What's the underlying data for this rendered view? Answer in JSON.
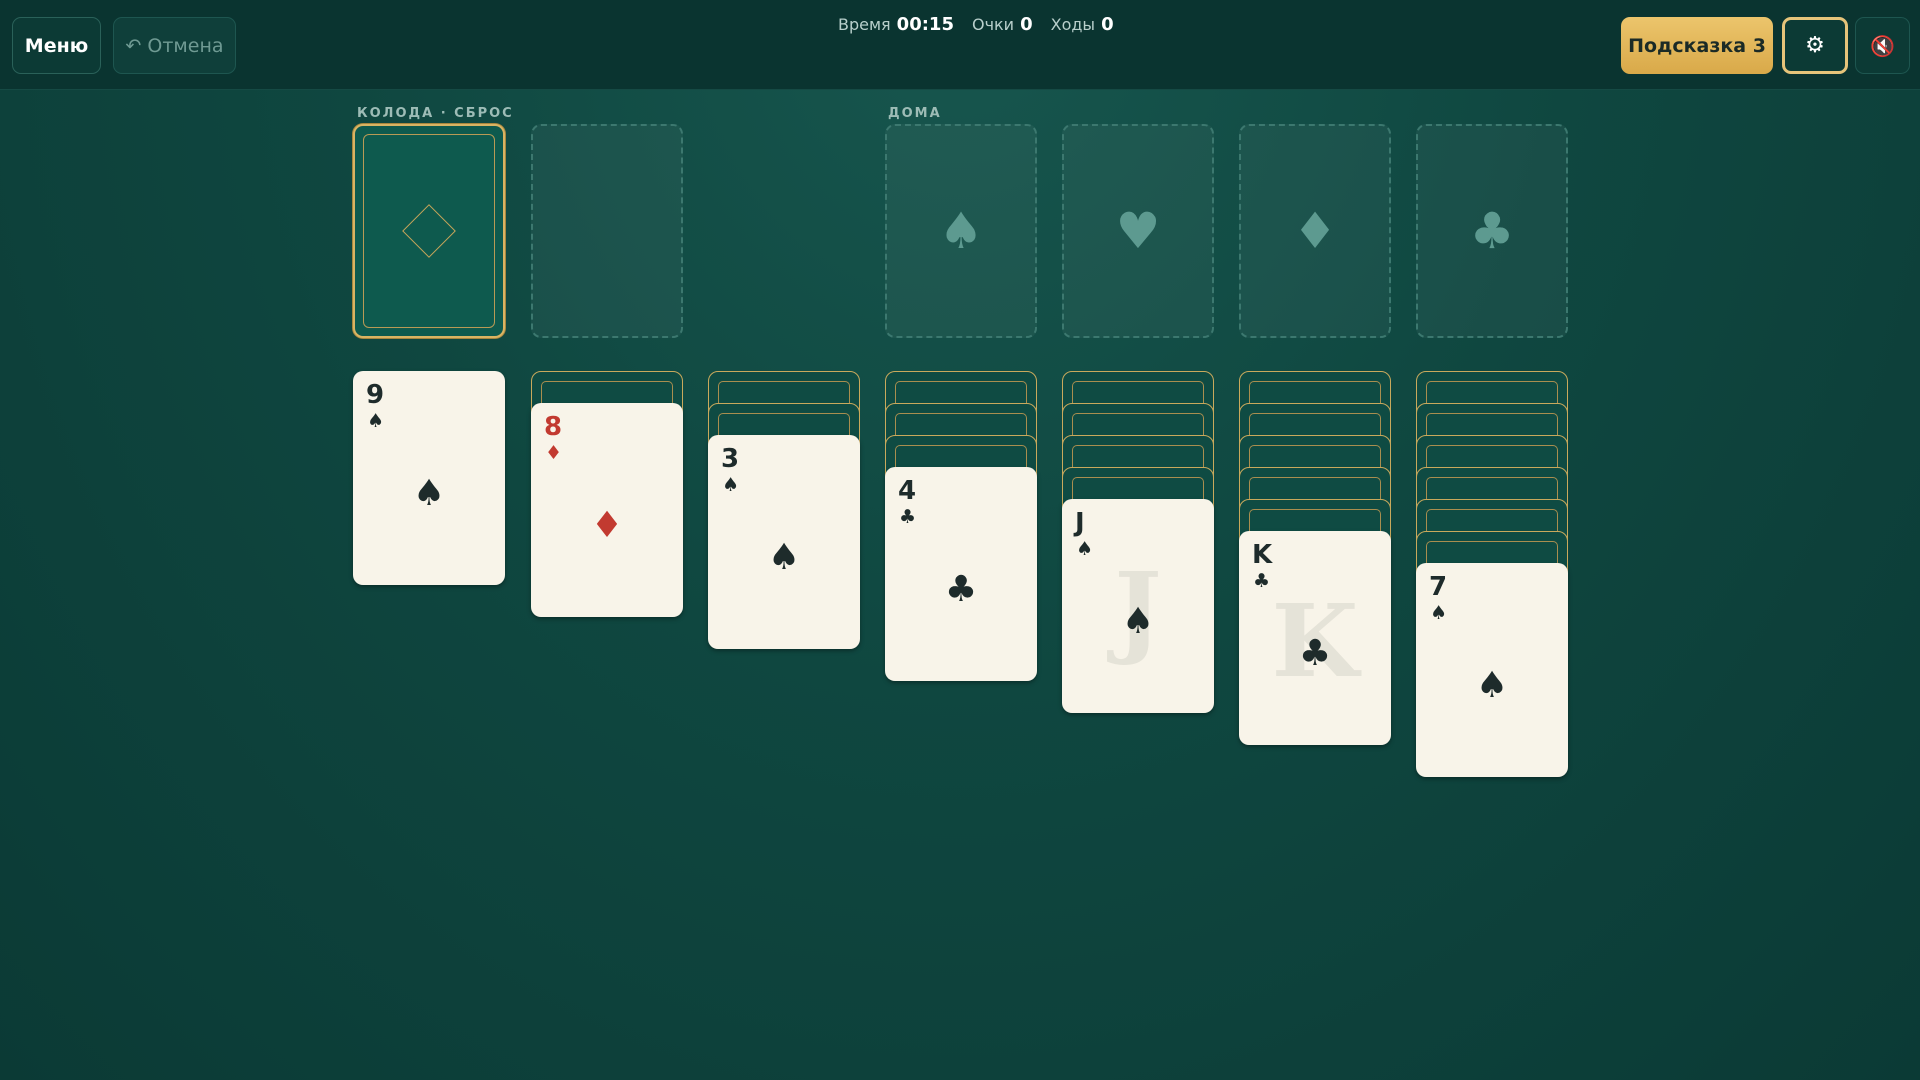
{
  "toolbar": {
    "menu_label": "Меню",
    "undo_label": "↶ Отмена",
    "hint_label": "Подсказка 3",
    "settings_icon": "⚙",
    "sound_icon": "🔇"
  },
  "stats": {
    "time_label": "Время",
    "time_value": "00:15",
    "score_label": "Очки",
    "score_value": "0",
    "moves_label": "Ходы",
    "moves_value": "0"
  },
  "labels": {
    "stock_waste": "КОЛОДА · СБРОС",
    "foundations": "ДОМА"
  },
  "foundations": [
    {
      "suit": "♠",
      "name": "spades"
    },
    {
      "suit": "♥",
      "name": "hearts"
    },
    {
      "suit": "♦",
      "name": "diamonds"
    },
    {
      "suit": "♣",
      "name": "clubs"
    }
  ],
  "tableau": [
    {
      "facedown": 0,
      "top": {
        "rank": "9",
        "suit": "♠",
        "color": "black"
      }
    },
    {
      "facedown": 1,
      "top": {
        "rank": "8",
        "suit": "♦",
        "color": "red"
      }
    },
    {
      "facedown": 2,
      "top": {
        "rank": "3",
        "suit": "♠",
        "color": "black"
      }
    },
    {
      "facedown": 3,
      "top": {
        "rank": "4",
        "suit": "♣",
        "color": "black"
      }
    },
    {
      "facedown": 4,
      "top": {
        "rank": "J",
        "suit": "♠",
        "color": "black",
        "face": true
      }
    },
    {
      "facedown": 5,
      "top": {
        "rank": "K",
        "suit": "♣",
        "color": "black",
        "face": true
      }
    },
    {
      "facedown": 6,
      "top": {
        "rank": "7",
        "suit": "♠",
        "color": "black"
      }
    }
  ],
  "colors": {
    "felt": "#0f4740",
    "gold": "#d9b463",
    "red_suit": "#c23a30",
    "black_suit": "#1e2b2b"
  }
}
